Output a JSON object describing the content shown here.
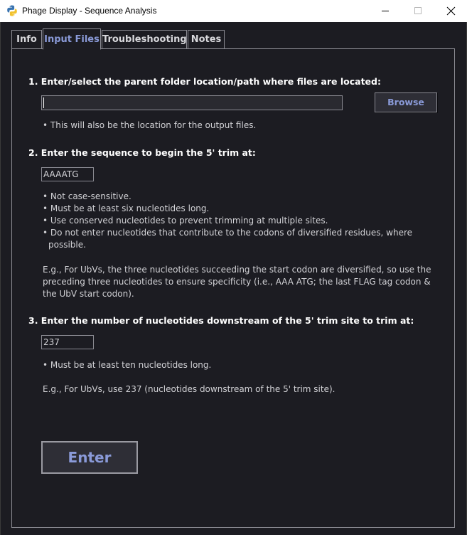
{
  "window": {
    "title": "Phage Display - Sequence Analysis"
  },
  "tabs": [
    {
      "label": "Info",
      "active": false
    },
    {
      "label": "Input Files",
      "active": true
    },
    {
      "label": "Troubleshooting",
      "active": false
    },
    {
      "label": "Notes",
      "active": false
    }
  ],
  "section1": {
    "heading": "1. Enter/select the parent folder location/path where files are located:",
    "path_value": "",
    "browse_label": "Browse",
    "note": "• This will also be the location for the output files."
  },
  "section2": {
    "heading": "2. Enter the sequence to begin the 5' trim at:",
    "sequence_value": "AAAATG",
    "bullets": [
      "• Not case-sensitive.",
      "• Must be at least six nucleotides long.",
      "• Use conserved nucleotides to prevent trimming at multiple sites.",
      "• Do not enter nucleotides that contribute to the codons of diversified residues, where",
      "possible."
    ],
    "example_lines": [
      "E.g., For UbVs, the three nucleotides succeeding the start codon are diversified, so use the",
      "preceding three nucleotides to ensure specificity (i.e., AAA ATG; the last FLAG tag codon &",
      "the UbV start codon)."
    ]
  },
  "section3": {
    "heading": "3. Enter the number of nucleotides downstream of the 5' trim site to trim at:",
    "count_value": "237",
    "bullet": "• Must be at least ten nucleotides long.",
    "example": "E.g., For UbVs, use 237 (nucleotides downstream of the 5' trim site)."
  },
  "enter_label": "Enter",
  "colors": {
    "background": "#1c1c22",
    "accent": "#8a9ad8",
    "border": "#8a8a92"
  }
}
